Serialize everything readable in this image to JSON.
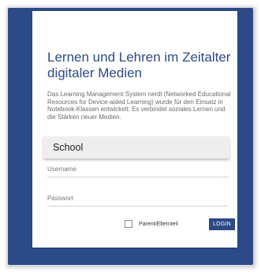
{
  "login": {
    "title": "Lernen und Lehren im Zeitalter digitaler Medien",
    "description": "Das Learning Management System nerdl (Networked Educational Resources for Device-aided Learning) wurde für den Einsatz in Notebook-Klassen entwickelt: Es verbindet soziales Lernen und die Stärken neuer Medien.",
    "school_value": "School",
    "username_placeholder": "Username",
    "password_placeholder": "Passwort",
    "checkbox_label": "Parent/Elternteil",
    "login_button": "LOGIN"
  },
  "colors": {
    "brand_blue": "#2c4a86",
    "card_background": "#ffffff",
    "school_field_background": "#eeeeee"
  },
  "icons": {
    "checkbox": "checkbox-unchecked-icon"
  }
}
